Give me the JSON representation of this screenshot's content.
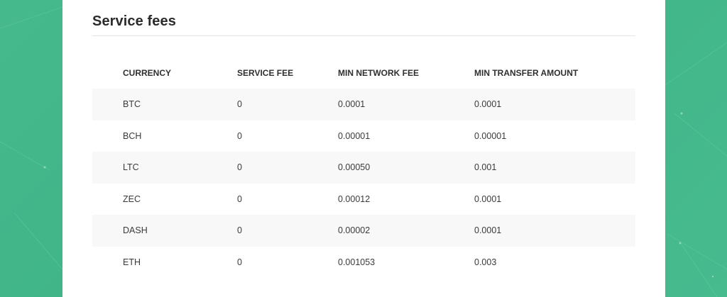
{
  "section": {
    "title": "Service fees"
  },
  "table": {
    "headers": [
      "CURRENCY",
      "SERVICE FEE",
      "MIN NETWORK FEE",
      "MIN TRANSFER AMOUNT"
    ],
    "rows": [
      [
        "BTC",
        "0",
        "0.0001",
        "0.0001"
      ],
      [
        "BCH",
        "0",
        "0.00001",
        "0.00001"
      ],
      [
        "LTC",
        "0",
        "0.00050",
        "0.001"
      ],
      [
        "ZEC",
        "0",
        "0.00012",
        "0.0001"
      ],
      [
        "DASH",
        "0",
        "0.00002",
        "0.0001"
      ],
      [
        "ETH",
        "0",
        "0.001053",
        "0.003"
      ]
    ]
  },
  "colors": {
    "background_green": "#44b88b",
    "card": "#ffffff",
    "row_stripe": "#f8f8f8",
    "text": "#2b2b2b"
  }
}
